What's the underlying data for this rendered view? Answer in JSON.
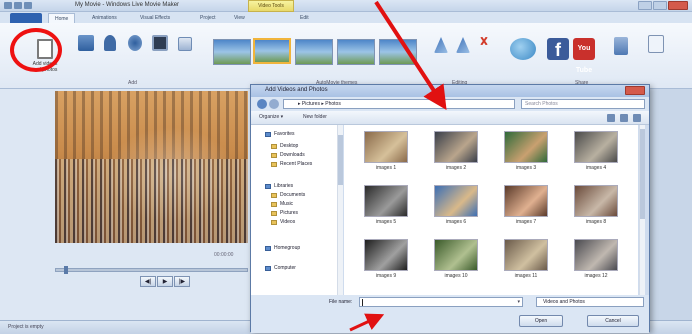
{
  "window": {
    "title": "My Movie - Windows Live Movie Maker",
    "context_tab": "Video Tools",
    "tabs": [
      "Home",
      "Animations",
      "Visual Effects",
      "Project",
      "View",
      "Edit"
    ]
  },
  "ribbon": {
    "add_button_label": "Add videos and photos",
    "group_labels": [
      "Add",
      "AutoMovie themes",
      "Editing",
      "Share"
    ],
    "icons": [
      "add-videos-photos-icon",
      "webcam-video-icon",
      "add-music-icon",
      "narration-icon",
      "snapshot-icon",
      "caption-icon",
      "rotate-left-icon",
      "rotate-right-icon",
      "skydrive-icon",
      "facebook-icon",
      "youtube-icon",
      "save-movie-icon",
      "sign-in-icon"
    ],
    "facebook_glyph": "f",
    "youtube_glyph": "You Tube"
  },
  "preview": {
    "timestamp": "00:00:00",
    "controls": [
      "◀|",
      "▶",
      "|▶"
    ]
  },
  "status": {
    "text": "Project is empty"
  },
  "dialog": {
    "title": "Add Videos and Photos",
    "path": "▸ Pictures ▸ Photos",
    "search_placeholder": "Search Photos",
    "toolbar": {
      "organize": "Organize ▾",
      "new_folder": "New folder"
    },
    "nav_items": [
      {
        "label": "Favorites",
        "type": "hdr"
      },
      {
        "label": "Desktop",
        "type": "sub"
      },
      {
        "label": "Downloads",
        "type": "sub"
      },
      {
        "label": "Recent Places",
        "type": "sub"
      },
      {
        "label": "Libraries",
        "type": "hdr"
      },
      {
        "label": "Documents",
        "type": "sub"
      },
      {
        "label": "Music",
        "type": "sub"
      },
      {
        "label": "Pictures",
        "type": "sub"
      },
      {
        "label": "Videos",
        "type": "sub"
      },
      {
        "label": "Homegroup",
        "type": "hdr"
      },
      {
        "label": "Computer",
        "type": "hdr"
      }
    ],
    "files": [
      {
        "name": "images 1",
        "color_a": "#8a6a4a",
        "color_b": "#d6c09a"
      },
      {
        "name": "images 2",
        "color_a": "#3a3f4a",
        "color_b": "#b9a58c"
      },
      {
        "name": "images 3",
        "color_a": "#2f6a3a",
        "color_b": "#c9a070"
      },
      {
        "name": "images 4",
        "color_a": "#4a4a4a",
        "color_b": "#b8b0a0"
      },
      {
        "name": "images 5",
        "color_a": "#2a2a2a",
        "color_b": "#9a9a9a"
      },
      {
        "name": "images 6",
        "color_a": "#3c6fb4",
        "color_b": "#d9b98a"
      },
      {
        "name": "images 7",
        "color_a": "#5a3a2a",
        "color_b": "#e0b090"
      },
      {
        "name": "images 8",
        "color_a": "#6a4a3a",
        "color_b": "#c8b8a8"
      },
      {
        "name": "images 9",
        "color_a": "#1e1e1e",
        "color_b": "#a0a0a0"
      },
      {
        "name": "images 10",
        "color_a": "#3a5a2a",
        "color_b": "#b0c090"
      },
      {
        "name": "images 11",
        "color_a": "#6a5a4a",
        "color_b": "#d0c0a0"
      },
      {
        "name": "images 12",
        "color_a": "#4a4a50",
        "color_b": "#c0b8b0"
      }
    ],
    "filename_label": "File name:",
    "filename_value": "",
    "filter": "Videos and Photos",
    "buttons": {
      "open": "Open",
      "cancel": "Cancel"
    }
  },
  "colors": {
    "annotation_red": "#e11111",
    "ribbon_blue": "#2f62b0"
  }
}
